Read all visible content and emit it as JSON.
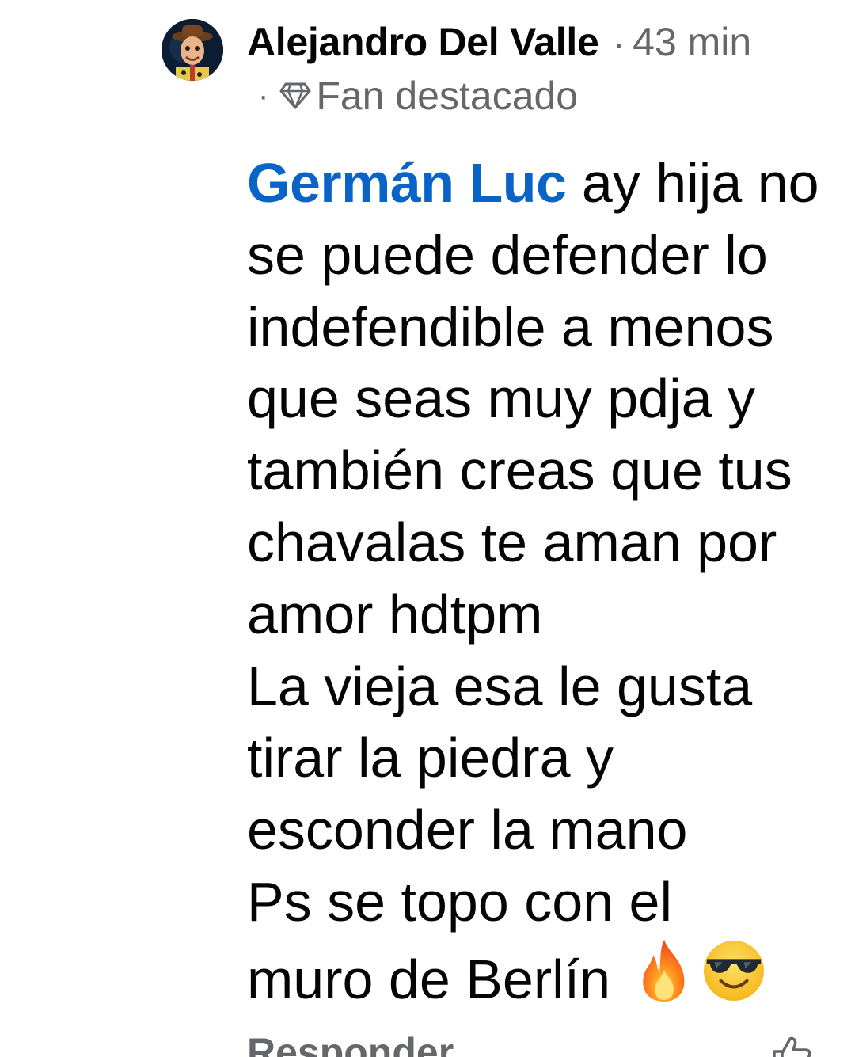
{
  "comment": {
    "author": "Alejandro Del Valle",
    "separator": "·",
    "time": "43 min",
    "badge_dot": "·",
    "badge_icon": "diamond-icon",
    "badge": "Fan destacado",
    "mention": "Germán Luc",
    "lines": [
      " ay hija no",
      "se puede defender lo",
      "indefendible a menos",
      "que seas muy pdja y",
      "también creas que tus",
      "chavalas te aman por",
      "amor hdtpm",
      "La vieja esa le gusta",
      "tirar la piedra y",
      "esconder la mano",
      "Ps se topo con el",
      "muro de Berlín "
    ],
    "emojis": [
      "fire-emoji",
      "sunglasses-emoji"
    ],
    "mention_color": "#0a64c8"
  },
  "actions": {
    "reply": "Responder",
    "like_icon": "thumbs-up-icon"
  }
}
